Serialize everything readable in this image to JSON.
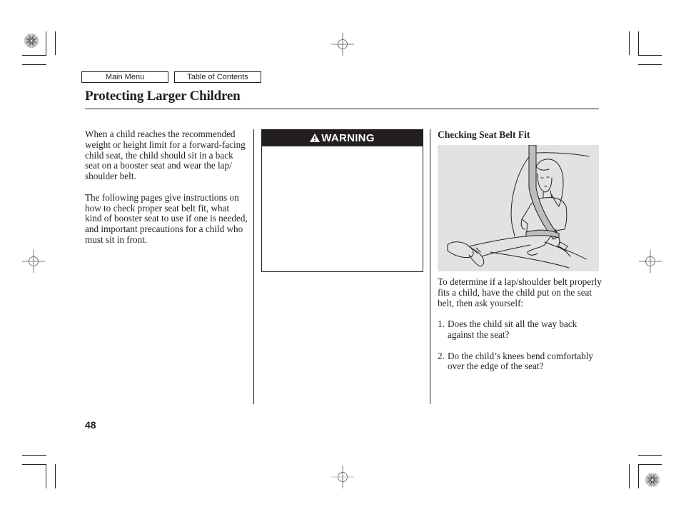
{
  "nav": {
    "main_menu_label": "Main Menu",
    "toc_label": "Table of Contents"
  },
  "page": {
    "title": "Protecting Larger Children",
    "page_number": "48"
  },
  "left_column": {
    "paragraphs": [
      "When a child reaches the recommended weight or height limit for a forward-facing child seat, the child should sit in a back seat on a booster seat and wear the lap/ shoulder belt.",
      "The following pages give instructions on how to check proper seat belt fit, what kind of booster seat to use if one is needed, and important precautions for a child who must sit in front."
    ]
  },
  "warning": {
    "icon": "warning-triangle-icon",
    "label": "WARNING",
    "body": ""
  },
  "right_column": {
    "heading": "Checking Seat Belt Fit",
    "illustration_description": "Child sitting on rear seat wearing lap/shoulder belt",
    "intro": "To determine if a lap/shoulder belt properly fits a child, have the child put on the seat belt, then ask yourself:",
    "questions": [
      {
        "num": "1.",
        "text": "Does the child sit all the way back against the seat?"
      },
      {
        "num": "2.",
        "text": "Do the child’s knees bend comfortably over the edge of the seat?"
      }
    ]
  },
  "colors": {
    "ink": "#231f20",
    "illustration_bg": "#e2e2e2",
    "warning_bar": "#231f20"
  }
}
